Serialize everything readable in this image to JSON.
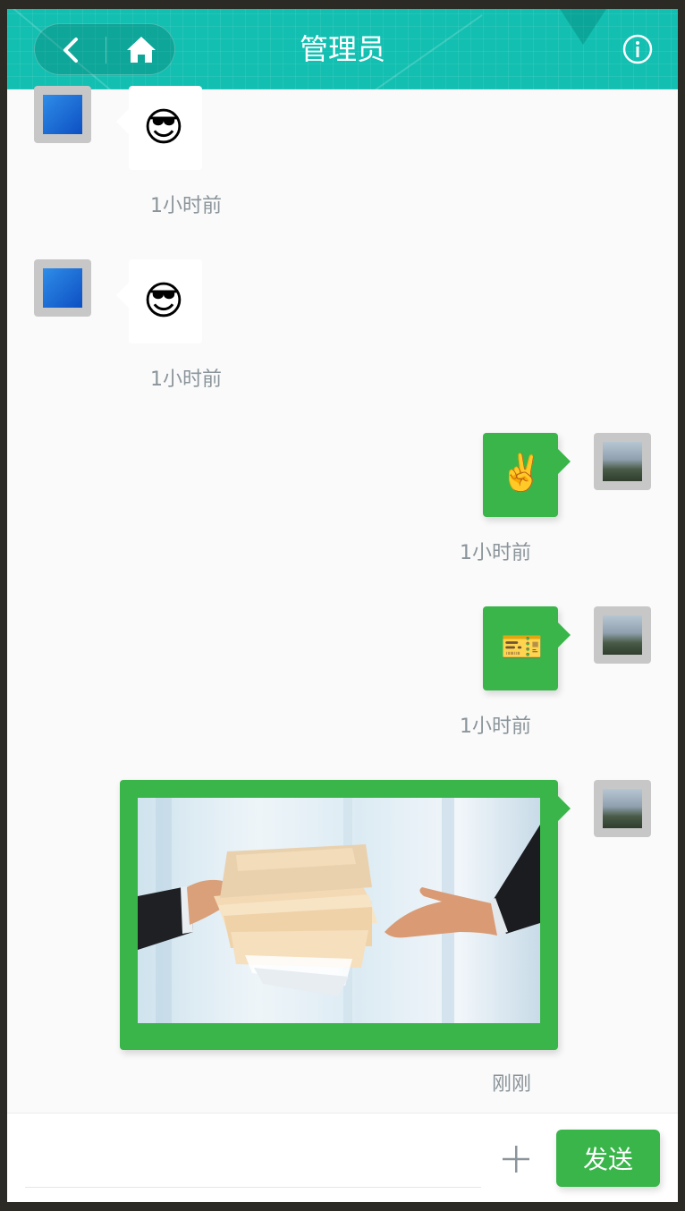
{
  "header": {
    "title": "管理员",
    "back_icon": "chevron-left-icon",
    "home_icon": "home-icon",
    "info_icon": "info-icon",
    "bg_color": "#12bfb1"
  },
  "messages": [
    {
      "side": "left",
      "type": "emoji",
      "emoji": "😎",
      "time": "1小时前"
    },
    {
      "side": "left",
      "type": "emoji",
      "emoji": "😎",
      "time": "1小时前"
    },
    {
      "side": "right",
      "type": "emoji",
      "emoji": "✌️",
      "time": "1小时前"
    },
    {
      "side": "right",
      "type": "emoji",
      "emoji": "🎫",
      "time": "1小时前"
    },
    {
      "side": "right",
      "type": "image",
      "image_desc": "handshake-documents-photo",
      "time": "刚刚"
    }
  ],
  "composer": {
    "input_value": "",
    "plus_icon": "plus-icon",
    "send_label": "发送",
    "accent": "#39b54a"
  }
}
